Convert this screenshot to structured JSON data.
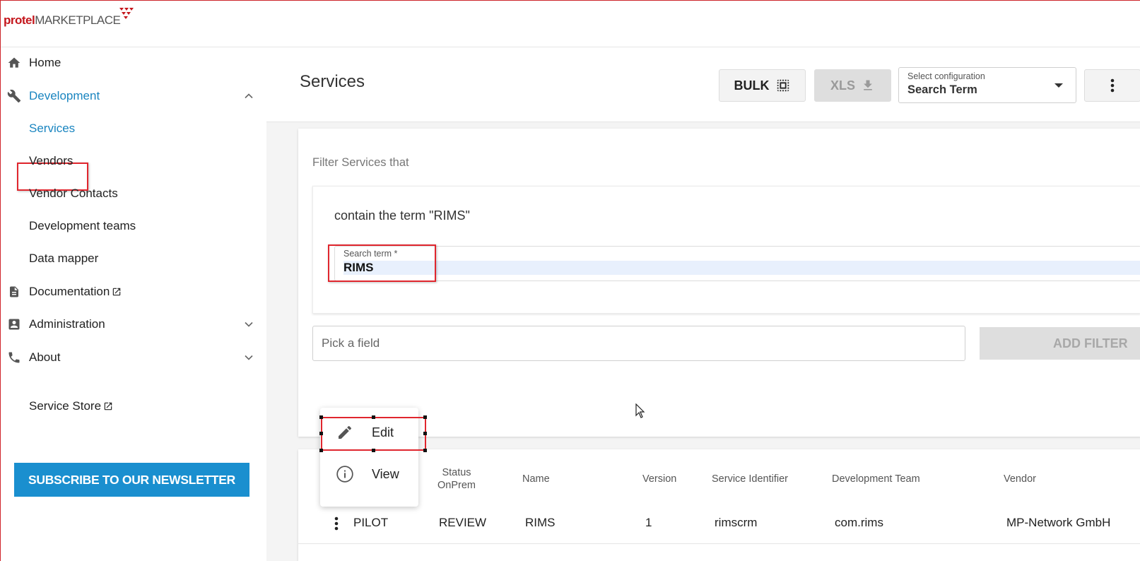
{
  "app": {
    "logo_part1": "protel",
    "logo_part2": "MARKETPLACE",
    "brand_color": "#c4161c",
    "accent_color": "#1a85c0"
  },
  "sidebar": {
    "items": [
      {
        "label": "Home",
        "icon": "home-icon"
      },
      {
        "label": "Development",
        "icon": "wrench-icon",
        "expanded": true
      },
      {
        "label": "Services",
        "active": true
      },
      {
        "label": "Vendors"
      },
      {
        "label": "Vendor Contacts"
      },
      {
        "label": "Development teams"
      },
      {
        "label": "Data mapper"
      },
      {
        "label": "Documentation",
        "icon": "document-icon",
        "external": true
      },
      {
        "label": "Administration",
        "icon": "account-box-icon"
      },
      {
        "label": "About",
        "icon": "phone-icon"
      },
      {
        "label": "Service Store",
        "external": true
      }
    ],
    "newsletter_label": "SUBSCRIBE TO OUR NEWSLETTER"
  },
  "header": {
    "title": "Services",
    "bulk_label": "BULK",
    "xls_label": "XLS",
    "config_label": "Select configuration",
    "config_value": "Search Term"
  },
  "filter": {
    "title": "Filter Services that",
    "criteria_text": "contain the term \"RIMS\"",
    "search_label": "Search term *",
    "search_value": "RIMS",
    "pick_placeholder": "Pick a field",
    "add_filter_label": "ADD FILTER"
  },
  "context_menu": {
    "edit_label": "Edit",
    "view_label": "View"
  },
  "table": {
    "columns": [
      "Status OnPrem",
      "Name",
      "Version",
      "Service Identifier",
      "Development Team",
      "Vendor"
    ],
    "status_onprem_line1": "Status",
    "status_onprem_line2": "OnPrem",
    "rows": [
      {
        "status": "PILOT",
        "status_onprem": "REVIEW",
        "name": "RIMS",
        "version": "1",
        "service_identifier": "rimscrm",
        "development_team": "com.rims",
        "vendor": "MP-Network GmbH"
      }
    ]
  }
}
